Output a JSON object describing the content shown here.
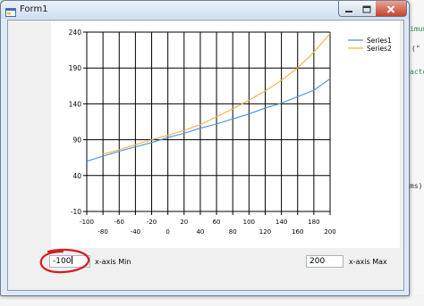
{
  "window": {
    "title": "Form1",
    "icon": "form-app-icon",
    "controls": [
      "minimize-icon",
      "maximize-icon",
      "close-icon"
    ]
  },
  "inputs": {
    "x_min": {
      "value": "-100",
      "label": "x-axis Min"
    },
    "x_max": {
      "value": "200",
      "label": "x-axis Max"
    }
  },
  "annotation": {
    "shape": "hand-drawn ellipse",
    "color": "#d21f1f",
    "target": "x-axis Min textbox"
  },
  "chart_data": {
    "type": "line",
    "xlim": [
      -100,
      200
    ],
    "ylim": [
      -10,
      240
    ],
    "x_ticks": [
      -100,
      -80,
      -60,
      -40,
      -20,
      0,
      20,
      40,
      60,
      80,
      100,
      120,
      140,
      160,
      180,
      200
    ],
    "y_ticks": [
      240,
      190,
      140,
      90,
      40,
      -10
    ],
    "grid": true,
    "legend_position": "top-right",
    "series": [
      {
        "name": "Series1",
        "color": "#4a90e2",
        "x": [
          -100,
          -80,
          -60,
          -40,
          -20,
          0,
          20,
          40,
          60,
          80,
          100,
          120,
          140,
          160,
          180,
          200
        ],
        "y": [
          60,
          67,
          74,
          80,
          86,
          93,
          99,
          106,
          112,
          119,
          126,
          134,
          141,
          150,
          159,
          175
        ]
      },
      {
        "name": "Series2",
        "color": "#f5b041",
        "x": [
          -80,
          -60,
          -40,
          -20,
          0,
          20,
          40,
          60,
          80,
          100,
          120,
          140,
          160,
          180,
          200
        ],
        "y": [
          70,
          76,
          83,
          90,
          96,
          103,
          111,
          122,
          133,
          145,
          158,
          173,
          190,
          212,
          238
        ]
      }
    ]
  },
  "background": {
    "code_fragments": [
      "imum",
      "(\"",
      "acto",
      "ms)"
    ]
  }
}
